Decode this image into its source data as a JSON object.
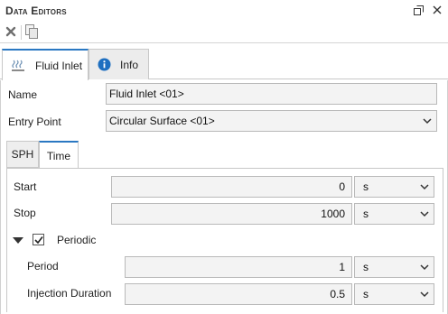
{
  "panel": {
    "title": "Data Editors",
    "float_icon": "restore-icon",
    "close_icon": "close-icon"
  },
  "toolbar": {
    "delete_icon": "delete-x-icon",
    "copy_icon": "copy-icon"
  },
  "tabs": [
    {
      "label": "Fluid Inlet",
      "icon": "fluid-inlet-icon",
      "active": true
    },
    {
      "label": "Info",
      "icon": "info-icon",
      "active": false
    }
  ],
  "form": {
    "name_label": "Name",
    "name_value": "Fluid Inlet <01>",
    "entry_point_label": "Entry Point",
    "entry_point_value": "Circular Surface <01>"
  },
  "subtabs": [
    {
      "label": "SPH",
      "active": false
    },
    {
      "label": "Time",
      "active": true
    }
  ],
  "time": {
    "start_label": "Start",
    "start_value": "0",
    "start_unit": "s",
    "stop_label": "Stop",
    "stop_value": "1000",
    "stop_unit": "s",
    "periodic_label": "Periodic",
    "periodic_checked": true,
    "period_label": "Period",
    "period_value": "1",
    "period_unit": "s",
    "injection_label": "Injection Duration",
    "injection_value": "0.5",
    "injection_unit": "s"
  },
  "colors": {
    "accent": "#2a78c2",
    "info_icon": "#1e6fc0"
  }
}
